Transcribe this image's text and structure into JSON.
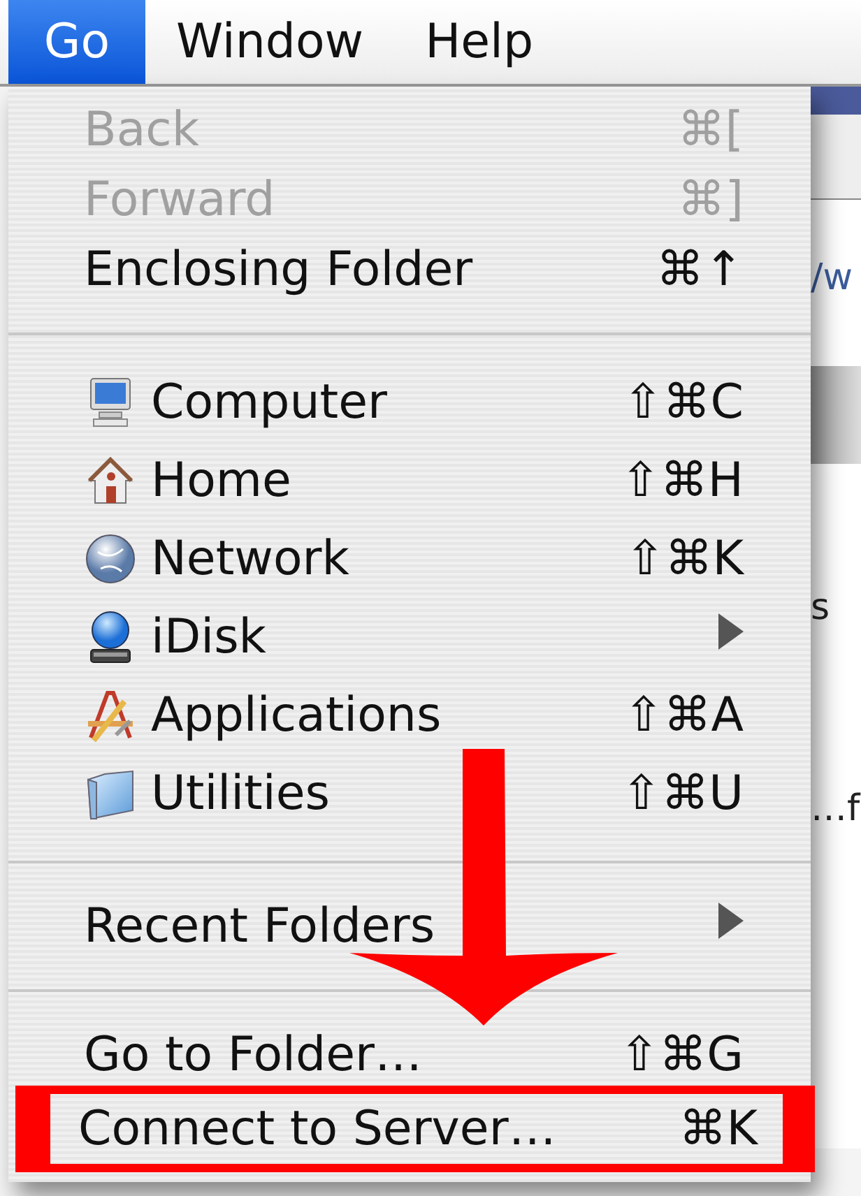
{
  "menubar": [
    {
      "label": "Go",
      "selected": true
    },
    {
      "label": "Window",
      "selected": false
    },
    {
      "label": "Help",
      "selected": false
    }
  ],
  "menu": {
    "items": [
      {
        "kind": "item",
        "label": "Back",
        "shortcut": "⌘[",
        "disabled": true
      },
      {
        "kind": "item",
        "label": "Forward",
        "shortcut": "⌘]",
        "disabled": true
      },
      {
        "kind": "item",
        "label": "Enclosing Folder",
        "shortcut": "⌘↑",
        "disabled": false
      },
      {
        "kind": "separator"
      },
      {
        "kind": "icon-item",
        "label": "Computer",
        "shortcut": "⇧⌘C",
        "disabled": false
      },
      {
        "kind": "icon-item",
        "label": "Home",
        "shortcut": "⇧⌘H",
        "disabled": false
      },
      {
        "kind": "icon-item",
        "label": "Network",
        "shortcut": "⇧⌘K",
        "disabled": false
      },
      {
        "kind": "icon-submenu",
        "label": "iDisk",
        "disabled": false
      },
      {
        "kind": "icon-item",
        "label": "Applications",
        "shortcut": "⇧⌘A",
        "disabled": false
      },
      {
        "kind": "icon-item",
        "label": "Utilities",
        "shortcut": "⇧⌘U",
        "disabled": false
      },
      {
        "kind": "separator"
      },
      {
        "kind": "submenu",
        "label": "Recent Folders",
        "disabled": false
      },
      {
        "kind": "separator"
      },
      {
        "kind": "item",
        "label": "Go to Folder…",
        "shortcut": "⇧⌘G",
        "disabled": false
      },
      {
        "kind": "item",
        "label": "Connect to Server…",
        "shortcut": "⌘K",
        "disabled": false,
        "marked": true
      }
    ]
  },
  "background_window": {
    "texts": [
      "/w",
      "s",
      "…f"
    ]
  }
}
